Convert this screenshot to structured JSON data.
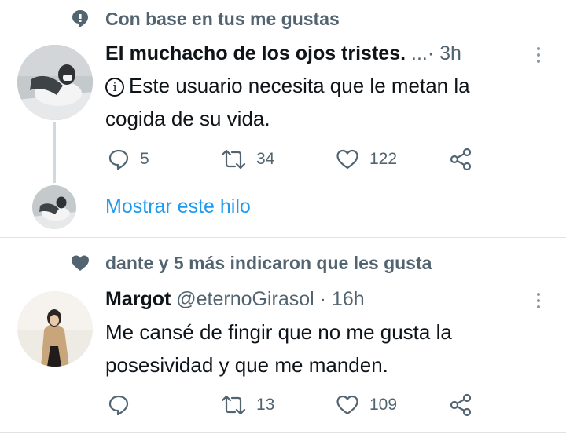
{
  "colors": {
    "accent": "#1d9bf0",
    "muted": "#536471",
    "text": "#0f1419"
  },
  "tweet1": {
    "social_icon": "speech-bubble-icon",
    "social_context": "Con base en tus me gustas",
    "author_name": "El muchacho de los ojos tristes.",
    "author_meta": " ...· 3h",
    "info_mark": "i",
    "text_line1": "Este usuario necesita que le metan la",
    "text_line2": "cogida de su vida.",
    "replies": "5",
    "retweets": "34",
    "likes": "122",
    "show_thread": "Mostrar este hilo"
  },
  "tweet2": {
    "social_icon": "heart-filled-icon",
    "social_context": "dante y 5 más indicaron que les gusta",
    "author_name": "Margot",
    "author_meta": " @eternoGirasol · 16h",
    "text_line1": "Me cansé de fingir que no me gusta la",
    "text_line2": "posesividad y que me manden.",
    "replies": "",
    "retweets": "13",
    "likes": "109"
  }
}
